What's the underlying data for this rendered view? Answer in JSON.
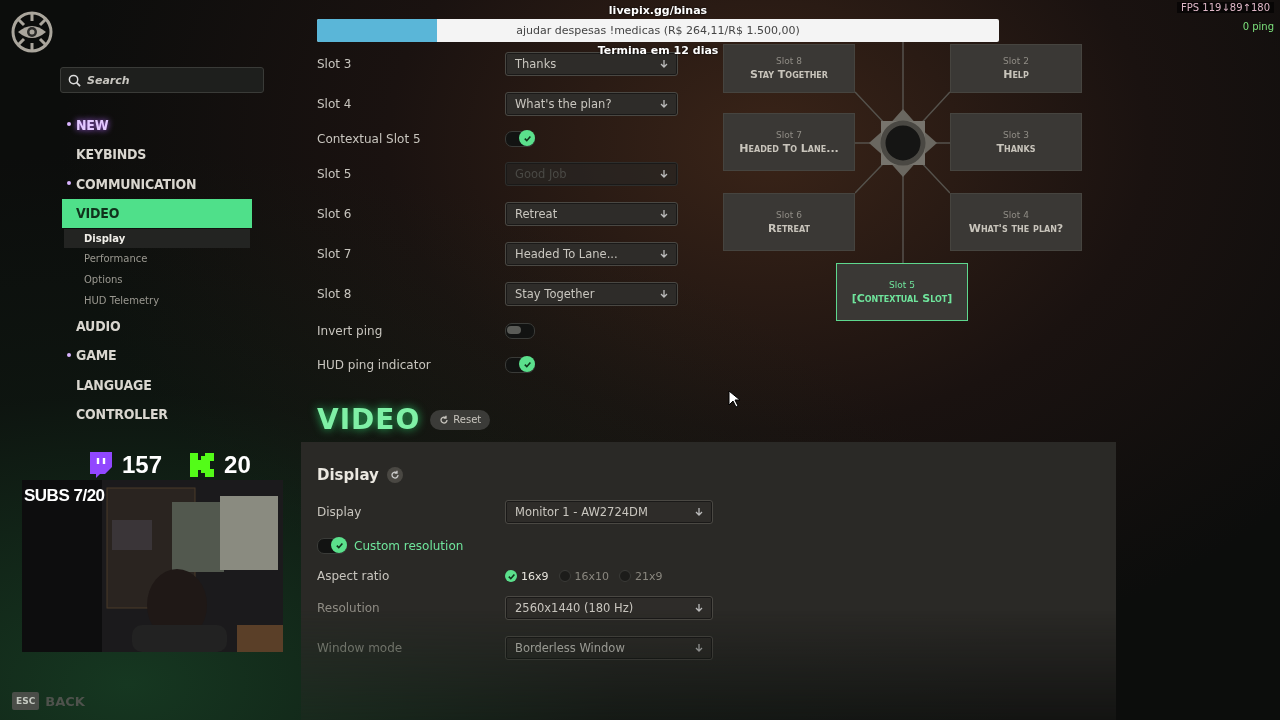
{
  "overlay": {
    "donation_link": "livepix.gg/binas",
    "goal_bar": {
      "label": "ajudar despesas !medicas (R$ 264,11/R$ 1.500,00)",
      "level": 0.176
    },
    "goal_ends": "Termina em 12 dias",
    "fps": "FPS 119↓89↑180",
    "ping": "0 ping"
  },
  "sidebar": {
    "search_placeholder": "Search",
    "nav": [
      {
        "label": "NEW",
        "marker": true,
        "accent": true,
        "selected": false
      },
      {
        "label": "KEYBINDS",
        "marker": false,
        "accent": false,
        "selected": false
      },
      {
        "label": "COMMUNICATION",
        "marker": true,
        "accent": false,
        "selected": false
      },
      {
        "label": "VIDEO",
        "marker": false,
        "accent": false,
        "selected": true,
        "children": [
          {
            "label": "Display",
            "selected": true
          },
          {
            "label": "Performance",
            "selected": false
          },
          {
            "label": "Options",
            "selected": false
          },
          {
            "label": "HUD Telemetry",
            "selected": false
          }
        ]
      },
      {
        "label": "AUDIO",
        "marker": false,
        "accent": false,
        "selected": false
      },
      {
        "label": "GAME",
        "marker": true,
        "accent": false,
        "selected": false
      },
      {
        "label": "LANGUAGE",
        "marker": false,
        "accent": false,
        "selected": false
      },
      {
        "label": "CONTROLLER",
        "marker": false,
        "accent": false,
        "selected": false
      }
    ]
  },
  "stream": {
    "twitch_viewers": "157",
    "kick_viewers": "20",
    "subs": "SUBS 7/20"
  },
  "back": {
    "key": "ESC",
    "label": "BACK"
  },
  "communication": {
    "rows": [
      {
        "kind": "dropdown",
        "label": "Slot 3",
        "value": "Thanks",
        "disabled": false
      },
      {
        "kind": "dropdown",
        "label": "Slot 4",
        "value": "What's the plan?",
        "disabled": false
      },
      {
        "kind": "toggle",
        "label": "Contextual Slot 5",
        "on": true
      },
      {
        "kind": "dropdown",
        "label": "Slot 5",
        "value": "Good Job",
        "disabled": true
      },
      {
        "kind": "dropdown",
        "label": "Slot 6",
        "value": "Retreat",
        "disabled": false
      },
      {
        "kind": "dropdown",
        "label": "Slot 7",
        "value": "Headed To Lane...",
        "disabled": false
      },
      {
        "kind": "dropdown",
        "label": "Slot 8",
        "value": "Stay Together",
        "disabled": false
      },
      {
        "kind": "toggle",
        "label": "Invert ping",
        "on": false
      },
      {
        "kind": "toggle",
        "label": "HUD ping indicator",
        "on": true
      }
    ]
  },
  "ping_wheel": {
    "slots": [
      {
        "slot": "Slot 8",
        "label": "Stay Together",
        "selected": false
      },
      {
        "slot": "Slot 2",
        "label": "Help",
        "selected": false
      },
      {
        "slot": "Slot 7",
        "label": "Headed To Lane...",
        "selected": false
      },
      {
        "slot": "Slot 3",
        "label": "Thanks",
        "selected": false
      },
      {
        "slot": "Slot 6",
        "label": "Retreat",
        "selected": false
      },
      {
        "slot": "Slot 4",
        "label": "What's the plan?",
        "selected": false
      },
      {
        "slot": "Slot 5",
        "label": "[Contextual Slot]",
        "selected": true
      }
    ]
  },
  "video": {
    "title": "VIDEO",
    "reset": "Reset",
    "display": {
      "title": "Display",
      "rows": [
        {
          "kind": "dropdown",
          "label": "Display",
          "value": "Monitor 1 - AW2724DM"
        },
        {
          "kind": "toggle",
          "label": "Custom resolution",
          "on": true
        },
        {
          "kind": "radio",
          "label": "Aspect ratio",
          "options": [
            {
              "label": "16x9",
              "selected": true
            },
            {
              "label": "16x10",
              "selected": false
            },
            {
              "label": "21x9",
              "selected": false
            }
          ]
        },
        {
          "kind": "dropdown",
          "label": "Resolution",
          "value": "2560x1440 (180 Hz)"
        },
        {
          "kind": "dropdown",
          "label": "Window mode",
          "value": "Borderless Window"
        }
      ]
    }
  }
}
